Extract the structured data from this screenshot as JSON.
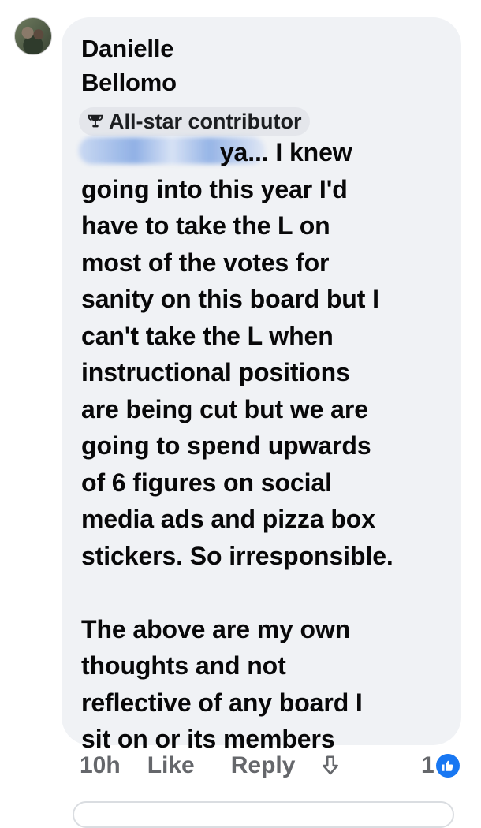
{
  "comment": {
    "author_line1": "Danielle",
    "author_line2": "Bellomo",
    "badge": "All-star contributor",
    "text": "                    ya... I knew\ngoing into this year I'd\nhave to take the L on\nmost of the votes for\nsanity on this board but I\ncan't take the L when\ninstructional positions\nare being cut but we are\ngoing to spend upwards\nof 6 figures on social\nmedia ads and pizza box\nstickers. So irresponsible.\n\nThe above are my own\nthoughts and not\nreflective of any board I\nsit on or its members"
  },
  "actions": {
    "time": "10h",
    "like": "Like",
    "reply": "Reply",
    "share_icon": "share-arrow-icon"
  },
  "reactions": {
    "count": "1",
    "icon": "like-reaction-icon",
    "color": "#1877f2"
  },
  "colors": {
    "bubble": "#f0f2f5",
    "badge_bg": "#e4e6eb",
    "meta_text": "#65676b"
  }
}
